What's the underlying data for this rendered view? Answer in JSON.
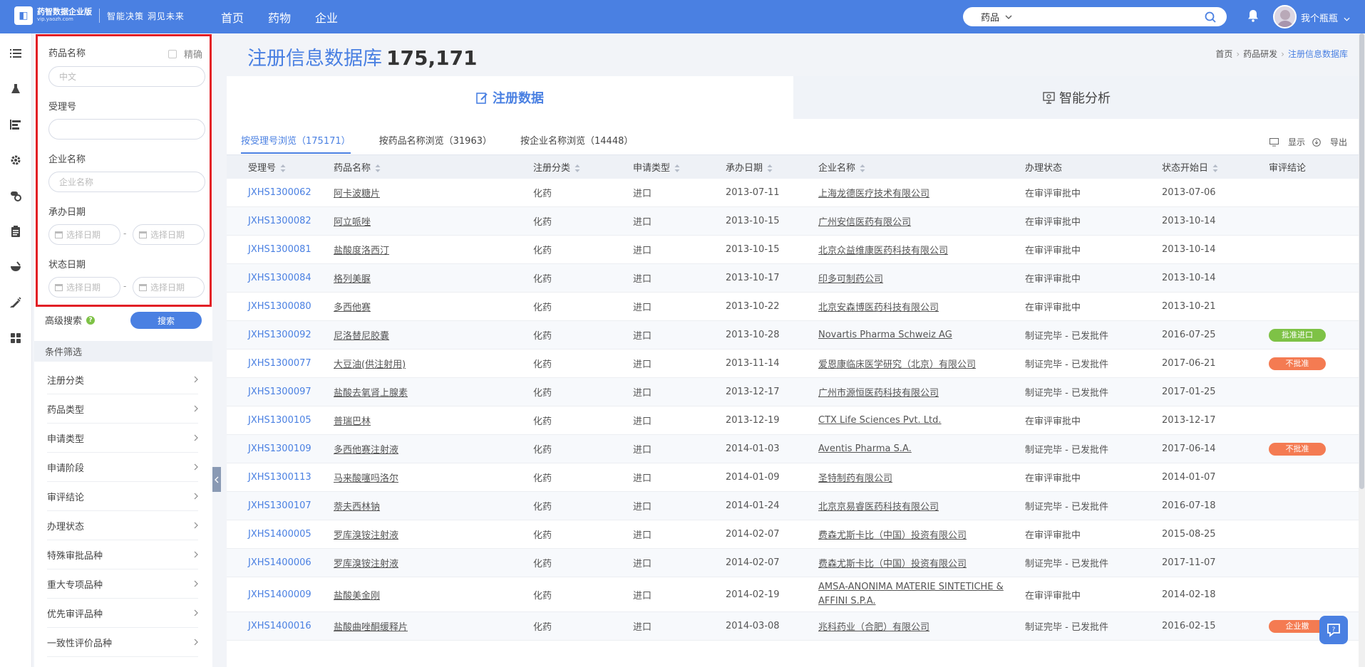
{
  "brand": {
    "name": "药智数据企业版",
    "url": "vip.yaozh.com",
    "slogan": "智能决策 洞见未来"
  },
  "nav": [
    "首页",
    "药物",
    "企业"
  ],
  "search": {
    "type": "药品",
    "placeholder": ""
  },
  "user": {
    "name": "我个瓶瓶"
  },
  "filter": {
    "drug_name_label": "药品名称",
    "exact_label": "精确",
    "drug_name_placeholder": "中文",
    "accept_no_label": "受理号",
    "accept_no_value": "",
    "company_label": "企业名称",
    "company_placeholder": "企业名称",
    "undertake_date_label": "承办日期",
    "status_date_label": "状态日期",
    "date_placeholder": "选择日期",
    "dash": "-",
    "advanced_label": "高级搜索",
    "help_mark": "?",
    "search_button": "搜索",
    "conditions_title": "条件筛选",
    "conditions": [
      "注册分类",
      "药品类型",
      "申请类型",
      "申请阶段",
      "审评结论",
      "办理状态",
      "特殊审批品种",
      "重大专项品种",
      "优先审评品种",
      "一致性评价品种"
    ]
  },
  "main": {
    "title": "注册信息数据库",
    "count": "175,171",
    "breadcrumb": [
      "首页",
      "药品研发",
      "注册信息数据库"
    ],
    "top_tabs": [
      "注册数据",
      "智能分析"
    ],
    "sub_tabs": [
      "按受理号浏览（175171）",
      "按药品名称浏览（31963）",
      "按企业名称浏览（14448）"
    ],
    "tools": {
      "display": "显示",
      "export": "导出"
    },
    "columns": [
      "受理号",
      "药品名称",
      "注册分类",
      "申请类型",
      "承办日期",
      "企业名称",
      "办理状态",
      "状态开始日",
      "审评结论"
    ],
    "rows": [
      {
        "id": "JXHS1300062",
        "drug": "阿卡波糖片",
        "cls": "化药",
        "type": "进口",
        "date": "2013-07-11",
        "company": "上海龙德医疗技术有限公司",
        "status": "在审评审批中",
        "start": "2013-07-06",
        "conclusion": ""
      },
      {
        "id": "JXHS1300082",
        "drug": "阿立哌唑",
        "cls": "化药",
        "type": "进口",
        "date": "2013-10-15",
        "company": "广州安信医药有限公司",
        "status": "在审评审批中",
        "start": "2013-10-14",
        "conclusion": ""
      },
      {
        "id": "JXHS1300081",
        "drug": "盐酸度洛西汀",
        "cls": "化药",
        "type": "进口",
        "date": "2013-10-15",
        "company": "北京众益维康医药科技有限公司",
        "status": "在审评审批中",
        "start": "2013-10-14",
        "conclusion": ""
      },
      {
        "id": "JXHS1300084",
        "drug": "格列美脲",
        "cls": "化药",
        "type": "进口",
        "date": "2013-10-17",
        "company": "印多可制药公司",
        "status": "在审评审批中",
        "start": "2013-10-14",
        "conclusion": ""
      },
      {
        "id": "JXHS1300080",
        "drug": "多西他赛",
        "cls": "化药",
        "type": "进口",
        "date": "2013-10-22",
        "company": "北京安森博医药科技有限公司",
        "status": "在审评审批中",
        "start": "2013-10-21",
        "conclusion": ""
      },
      {
        "id": "JXHS1300092",
        "drug": "尼洛替尼胶囊",
        "cls": "化药",
        "type": "进口",
        "date": "2013-10-28",
        "company": "Novartis Pharma Schweiz AG",
        "status": "制证完毕 - 已发批件",
        "start": "2016-07-25",
        "conclusion": "批准进口"
      },
      {
        "id": "JXHS1300077",
        "drug": "大豆油(供注射用)",
        "cls": "化药",
        "type": "进口",
        "date": "2013-11-14",
        "company": "爱恩康临床医学研究（北京）有限公司",
        "status": "制证完毕 - 已发批件",
        "start": "2017-06-21",
        "conclusion": "不批准"
      },
      {
        "id": "JXHS1300097",
        "drug": "盐酸去氧肾上腺素",
        "cls": "化药",
        "type": "进口",
        "date": "2013-12-17",
        "company": "广州市源恒医药科技有限公司",
        "status": "制证完毕 - 已发批件",
        "start": "2017-01-25",
        "conclusion": ""
      },
      {
        "id": "JXHS1300105",
        "drug": "普瑞巴林",
        "cls": "化药",
        "type": "进口",
        "date": "2013-12-19",
        "company": "CTX Life Sciences Pvt. Ltd.",
        "status": "在审评审批中",
        "start": "2013-12-17",
        "conclusion": ""
      },
      {
        "id": "JXHS1300109",
        "drug": "多西他赛注射液",
        "cls": "化药",
        "type": "进口",
        "date": "2014-01-03",
        "company": "Aventis Pharma S.A.",
        "status": "制证完毕 - 已发批件",
        "start": "2017-06-14",
        "conclusion": "不批准"
      },
      {
        "id": "JXHS1300113",
        "drug": "马来酸噻吗洛尔",
        "cls": "化药",
        "type": "进口",
        "date": "2014-01-09",
        "company": "圣特制药有限公司",
        "status": "在审评审批中",
        "start": "2014-01-07",
        "conclusion": ""
      },
      {
        "id": "JXHS1300107",
        "drug": "萘夫西林钠",
        "cls": "化药",
        "type": "进口",
        "date": "2014-01-24",
        "company": "北京京易睿医药科技有限公司",
        "status": "制证完毕 - 已发批件",
        "start": "2016-07-18",
        "conclusion": ""
      },
      {
        "id": "JXHS1400005",
        "drug": "罗库溴铵注射液",
        "cls": "化药",
        "type": "进口",
        "date": "2014-02-07",
        "company": "费森尤斯卡比（中国）投资有限公司",
        "status": "在审评审批中",
        "start": "2015-08-25",
        "conclusion": ""
      },
      {
        "id": "JXHS1400006",
        "drug": "罗库溴铵注射液",
        "cls": "化药",
        "type": "进口",
        "date": "2014-02-07",
        "company": "费森尤斯卡比（中国）投资有限公司",
        "status": "制证完毕 - 已发批件",
        "start": "2017-11-07",
        "conclusion": ""
      },
      {
        "id": "JXHS1400009",
        "drug": "盐酸美金刚",
        "cls": "化药",
        "type": "进口",
        "date": "2014-02-19",
        "company": "AMSA-ANONIMA MATERIE SINTETICHE & AFFINI S.P.A.",
        "status": "在审评审批中",
        "start": "2014-02-18",
        "conclusion": ""
      },
      {
        "id": "JXHS1400016",
        "drug": "盐酸曲唑酮缓释片",
        "cls": "化药",
        "type": "进口",
        "date": "2014-03-08",
        "company": "兆科药业（合肥）有限公司",
        "status": "制证完毕 - 已发批件",
        "start": "2016-02-15",
        "conclusion": "企业撤"
      }
    ]
  },
  "colors": {
    "accent": "#4a80e2",
    "approve": "#7ec246",
    "reject": "#f47b52",
    "highlight": "#e21f26"
  }
}
